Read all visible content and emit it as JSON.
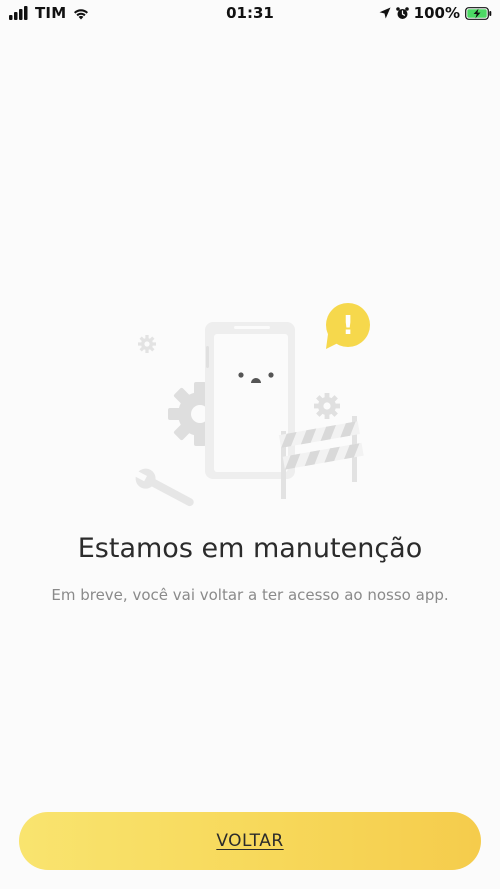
{
  "status_bar": {
    "carrier": "TIM",
    "time": "01:31",
    "battery": "100%",
    "icons": [
      "signal-bars-icon",
      "wifi-icon",
      "location-arrow-icon",
      "alarm-clock-icon",
      "battery-charging-icon"
    ]
  },
  "maintenance": {
    "title": "Estamos em manutenção",
    "subtitle": "Em breve, você vai voltar a ter acesso ao nosso app.",
    "alert_symbol": "!"
  },
  "actions": {
    "back_label": "VOLTAR"
  },
  "colors": {
    "background": "#fbfbfb",
    "accent_yellow": "#f7d85a",
    "illustration_gray": "#e6e6e6"
  }
}
